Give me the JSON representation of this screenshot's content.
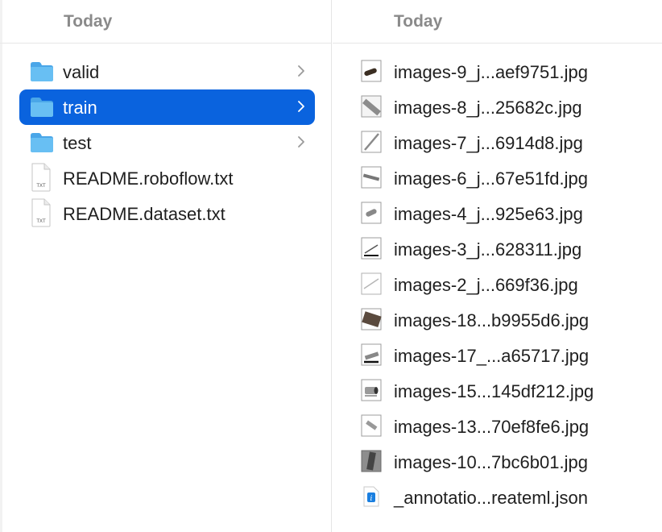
{
  "columns": {
    "left": {
      "header": "Today",
      "items": [
        {
          "label": "valid",
          "kind": "folder",
          "selected": false
        },
        {
          "label": "train",
          "kind": "folder",
          "selected": true
        },
        {
          "label": "test",
          "kind": "folder",
          "selected": false
        },
        {
          "label": "README.roboflow.txt",
          "kind": "txt-file",
          "icon_text": "TXT"
        },
        {
          "label": "README.dataset.txt",
          "kind": "txt-file",
          "icon_text": "TXT"
        }
      ]
    },
    "right": {
      "header": "Today",
      "items": [
        {
          "label": "images-9_j...aef9751.jpg"
        },
        {
          "label": "images-8_j...25682c.jpg"
        },
        {
          "label": "images-7_j...6914d8.jpg"
        },
        {
          "label": "images-6_j...67e51fd.jpg"
        },
        {
          "label": "images-4_j...925e63.jpg"
        },
        {
          "label": "images-3_j...628311.jpg"
        },
        {
          "label": "images-2_j...669f36.jpg"
        },
        {
          "label": "images-18...b9955d6.jpg"
        },
        {
          "label": "images-17_...a65717.jpg"
        },
        {
          "label": "images-15...145df212.jpg"
        },
        {
          "label": "images-13...70ef8fe6.jpg"
        },
        {
          "label": "images-10...7bc6b01.jpg"
        },
        {
          "label": "_annotatio...reateml.json"
        }
      ]
    }
  },
  "colors": {
    "selection": "#0a63de",
    "folder": "#5bb4ef",
    "header_text": "#8a8a8a",
    "item_text": "#1f1f1f"
  }
}
